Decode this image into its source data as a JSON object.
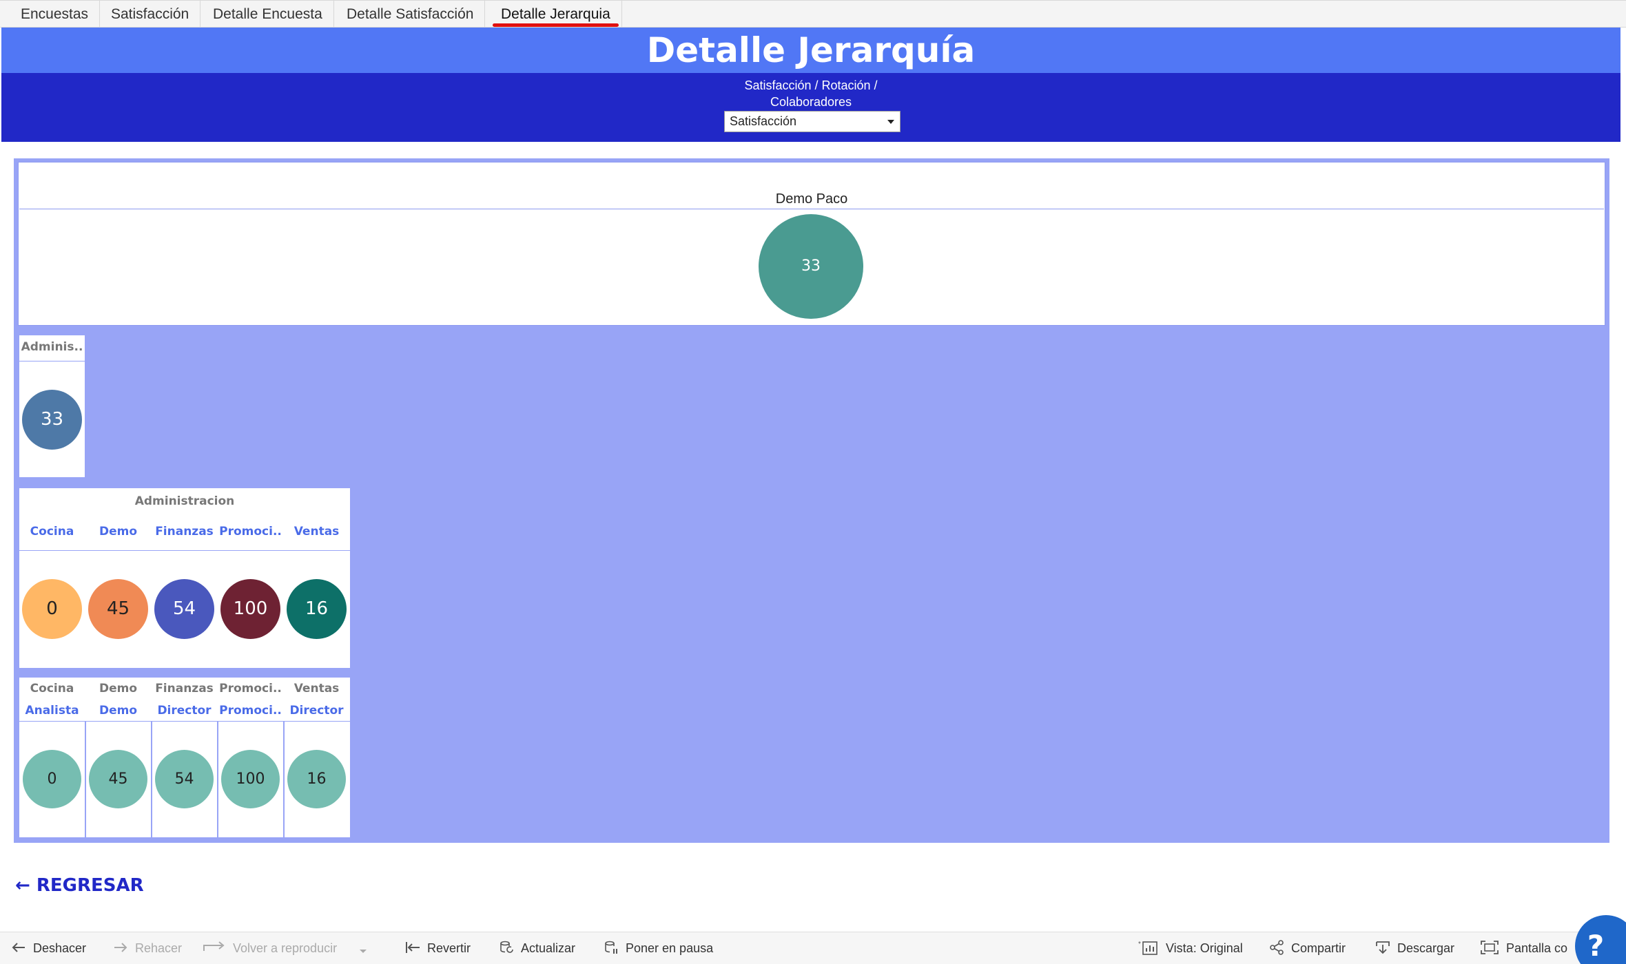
{
  "tabs": [
    {
      "label": "Encuestas",
      "active": false
    },
    {
      "label": "Satisfacción",
      "active": false
    },
    {
      "label": "Detalle Encuesta",
      "active": false
    },
    {
      "label": "Detalle Satisfacción",
      "active": false
    },
    {
      "label": "Detalle Jerarquia",
      "active": true
    }
  ],
  "header": {
    "title": "Detalle Jerarquía",
    "subtitle_line1": "Satisfacción / Rotación /",
    "subtitle_line2": "Colaboradores",
    "dropdown_value": "Satisfacción"
  },
  "top": {
    "label": "Demo Paco",
    "value": "33",
    "color": "#4a9b91"
  },
  "level1": {
    "label": "Adminis..",
    "value": "33",
    "color": "#4e79a7"
  },
  "level2": {
    "title": "Administracion",
    "items": [
      {
        "label": "Cocina",
        "value": "0",
        "color": "#ffb765"
      },
      {
        "label": "Demo",
        "value": "45",
        "color": "#f08a55"
      },
      {
        "label": "Finanzas",
        "value": "54",
        "color": "#4a58bd"
      },
      {
        "label": "Promoci..",
        "value": "100",
        "color": "#6e2233"
      },
      {
        "label": "Ventas",
        "value": "16",
        "color": "#0d7068"
      }
    ]
  },
  "level3": {
    "items": [
      {
        "group": "Cocina",
        "label": "Analista",
        "value": "0"
      },
      {
        "group": "Demo",
        "label": "Demo",
        "value": "45"
      },
      {
        "group": "Finanzas",
        "label": "Director",
        "value": "54"
      },
      {
        "group": "Promoci..",
        "label": "Promoci..",
        "value": "100"
      },
      {
        "group": "Ventas",
        "label": "Director",
        "value": "16"
      }
    ],
    "color": "#76bdb1"
  },
  "back_label": "← REGRESAR",
  "toolbar": {
    "undo": "Deshacer",
    "redo": "Rehacer",
    "replay": "Volver a reproducir",
    "revert": "Revertir",
    "refresh": "Actualizar",
    "pause": "Poner en pausa",
    "view": "Vista: Original",
    "share": "Compartir",
    "download": "Descargar",
    "fullscreen": "Pantalla co"
  },
  "help_label": "?"
}
